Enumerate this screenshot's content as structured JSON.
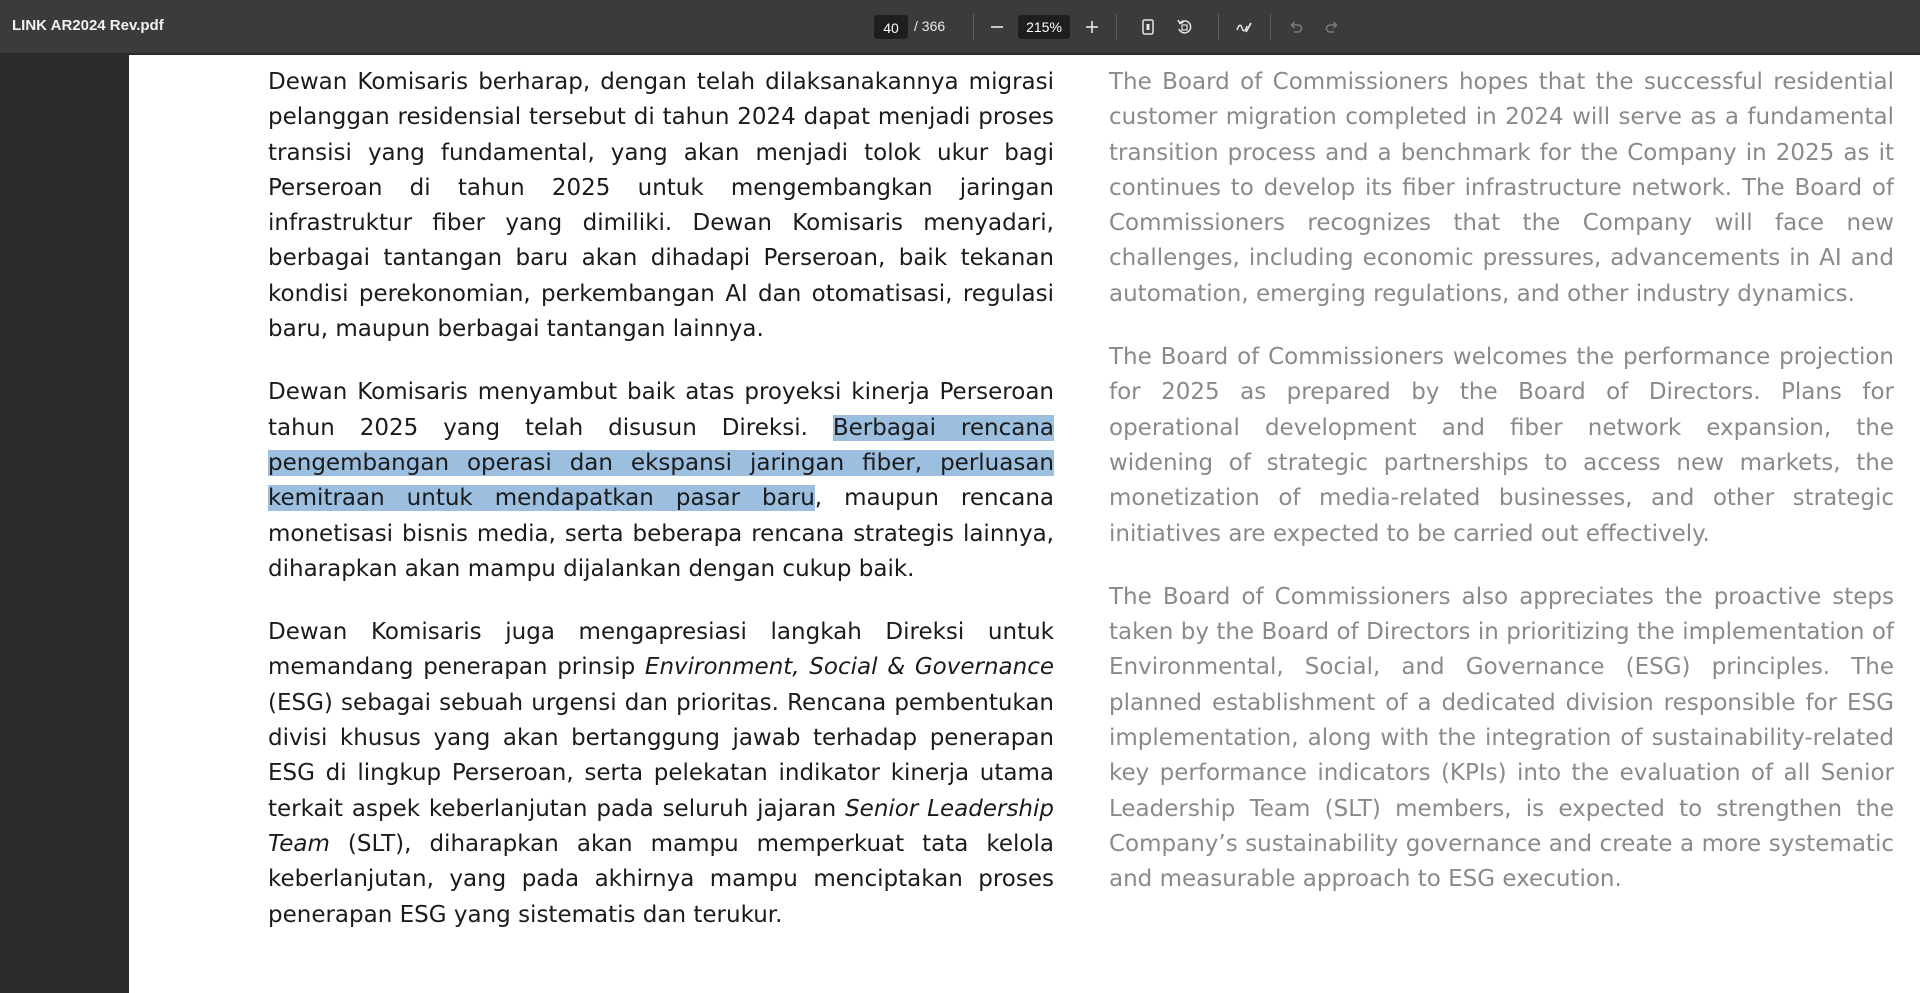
{
  "toolbar": {
    "doc_title": "LINK AR2024 Rev.pdf",
    "current_page": "40",
    "total_pages": "/ 366",
    "zoom": "215%",
    "icons": [
      "zoom-out-icon",
      "zoom-in-icon",
      "fit-page-icon",
      "rotate-icon",
      "draw-icon",
      "undo-icon",
      "redo-icon"
    ]
  },
  "colors": {
    "toolbar_bg": "#3b3b3b",
    "viewer_bg": "#2b2b2b",
    "selection_highlight": "#9cbfe0",
    "indonesian_text": "#1b1b1b",
    "english_text": "#8a8a8a"
  },
  "content": {
    "id": {
      "p1": "Dewan Komisaris berharap, dengan telah dilaksanakannya migrasi pelanggan residensial tersebut di tahun 2024 dapat menjadi proses transisi yang fundamental, yang akan menjadi tolok ukur bagi Perseroan di tahun 2025 untuk mengembangkan jaringan infrastruktur fiber yang dimiliki. Dewan Komisaris menyadari, berbagai tantangan baru akan dihadapi Perseroan, baik tekanan kondisi perekonomian, perkembangan AI dan otomatisasi, regulasi baru, maupun berbagai tantangan lainnya.",
      "p2_before": "Dewan Komisaris menyambut baik atas proyeksi kinerja Perseroan tahun 2025 yang telah disusun Direksi. ",
      "p2_selected": "Berbagai rencana pengembangan operasi dan ekspansi jaringan fiber, perluasan kemitraan untuk mendapatkan pasar baru",
      "p2_after": ", maupun rencana monetisasi bisnis media, serta beberapa rencana strategis lainnya, diharapkan akan mampu dijalankan dengan cukup baik.",
      "p3_a": "Dewan Komisaris juga mengapresiasi langkah Direksi untuk memandang penerapan prinsip ",
      "p3_em1": "Environment, Social & Governance",
      "p3_b": " (ESG) sebagai sebuah urgensi dan prioritas. Rencana pembentukan divisi khusus yang akan bertanggung jawab terhadap penerapan ESG di lingkup Perseroan, serta pelekatan indikator kinerja utama terkait aspek keberlanjutan pada seluruh jajaran ",
      "p3_em2": "Senior Leadership Team",
      "p3_c": " (SLT), diharapkan akan mampu memperkuat tata kelola keberlanjutan, yang pada akhirnya mampu menciptakan proses penerapan ESG yang sistematis dan terukur."
    },
    "en": {
      "p1": "The Board of Commissioners hopes that the successful residential customer migration completed in 2024 will serve as a fundamental transition process and a benchmark for the Company in 2025 as it continues to develop its fiber infrastructure network. The Board of Commissioners recognizes that the Company will face new challenges, including economic pressures, advancements in AI and automation, emerging regulations, and other industry dynamics.",
      "p2": "The Board of Commissioners welcomes the performance projection for 2025 as prepared by the Board of Directors. Plans for operational development and fiber network expansion, the widening of strategic partnerships to access new markets, the monetization of media-related businesses, and other strategic initiatives are expected to be carried out effectively.",
      "p3": "The Board of Commissioners also appreciates the proactive steps taken by the Board of Directors in prioritizing the implementation of Environmental, Social, and Governance (ESG) principles. The planned establishment of a dedicated division responsible for ESG implementation, along with the integration of sustainability-related key performance indicators (KPIs) into the evaluation of all Senior Leadership Team (SLT) members, is expected to strengthen the Company’s sustainability governance and create a more systematic and measurable approach to ESG execution."
    }
  }
}
